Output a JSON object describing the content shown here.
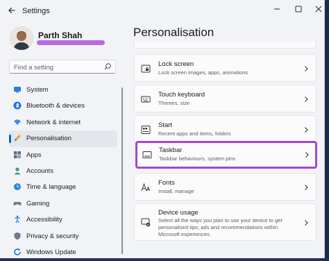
{
  "window": {
    "app_title": "Settings"
  },
  "profile": {
    "name": "Parth Shah"
  },
  "search": {
    "placeholder": "Find a setting"
  },
  "nav": {
    "items": [
      {
        "label": "System",
        "icon": "monitor-icon"
      },
      {
        "label": "Bluetooth & devices",
        "icon": "bluetooth-icon"
      },
      {
        "label": "Network & internet",
        "icon": "wifi-icon"
      },
      {
        "label": "Personalisation",
        "icon": "pen-icon",
        "active": true
      },
      {
        "label": "Apps",
        "icon": "apps-icon"
      },
      {
        "label": "Accounts",
        "icon": "person-icon"
      },
      {
        "label": "Time & language",
        "icon": "globe-clock-icon"
      },
      {
        "label": "Gaming",
        "icon": "gamepad-icon"
      },
      {
        "label": "Accessibility",
        "icon": "accessibility-icon"
      },
      {
        "label": "Privacy & security",
        "icon": "shield-icon"
      },
      {
        "label": "Windows Update",
        "icon": "update-icon"
      }
    ]
  },
  "main": {
    "title": "Personalisation",
    "cards": [
      {
        "title": "Lock screen",
        "subtitle": "Lock screen images, apps, animations",
        "icon": "lock-screen-icon"
      },
      {
        "title": "Touch keyboard",
        "subtitle": "Themes, size",
        "icon": "keyboard-icon"
      },
      {
        "title": "Start",
        "subtitle": "Recent apps and items, folders",
        "icon": "start-icon"
      },
      {
        "title": "Taskbar",
        "subtitle": "Taskbar behaviours, system pins",
        "icon": "taskbar-icon",
        "highlighted": true
      },
      {
        "title": "Fonts",
        "subtitle": "Install, manage",
        "icon": "fonts-icon"
      },
      {
        "title": "Device usage",
        "subtitle": "Select all the ways you plan to use your device to get personalised tips, ads and recommendations within Microsoft experiences.",
        "icon": "device-usage-icon"
      }
    ]
  },
  "colors": {
    "accent": "#0067c0",
    "highlight_border": "#a646d1",
    "redaction": "#b86ae0"
  }
}
